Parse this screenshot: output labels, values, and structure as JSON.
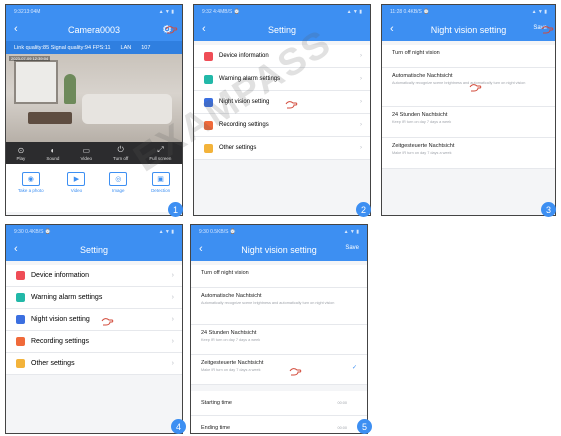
{
  "colors": {
    "accent": "#3d8ff2",
    "frame_border": "#444444",
    "badge": "#3d8ff2"
  },
  "watermark": "EXAMPASS",
  "panel1": {
    "status_left": "9:3213:04M",
    "status_right": "▲ ▼ ▮",
    "title": "Camera0003",
    "info": {
      "link_quality": "Link quality:85 Signal quality:94 FPS:11",
      "lan": "LAN",
      "rate": "107"
    },
    "cam_stamp": "2023-07-09 12:39:04",
    "controls": [
      {
        "icon": "play-icon",
        "glyph": "⊙",
        "label": "Play"
      },
      {
        "icon": "sound-icon",
        "glyph": "◐",
        "label": "Sound"
      },
      {
        "icon": "video-icon",
        "glyph": "▭",
        "label": "Video"
      },
      {
        "icon": "turn-off-icon",
        "glyph": "⏻",
        "label": "Turn off"
      },
      {
        "icon": "fullscreen-icon",
        "glyph": "⤢",
        "label": "Full screen"
      }
    ],
    "bottom": [
      {
        "icon": "camera-icon",
        "glyph": "◉",
        "label": "Take a photo"
      },
      {
        "icon": "video-file-icon",
        "glyph": "▶",
        "label": "Video"
      },
      {
        "icon": "image-icon",
        "glyph": "◎",
        "label": "Image"
      },
      {
        "icon": "detection-icon",
        "glyph": "▣",
        "label": "Detection"
      }
    ],
    "badge": "1"
  },
  "panel2": {
    "status_left": "9:32 4:4MB/S ⌚",
    "status_right": "▲ ▼ ▮",
    "title": "Setting",
    "items": [
      {
        "label": "Device information",
        "color": "#ef4d56"
      },
      {
        "label": "Warning alarm settings",
        "color": "#22b8a8"
      },
      {
        "label": "Night vision setting",
        "color": "#3b6fe0"
      },
      {
        "label": "Recording settings",
        "color": "#f06a3a"
      },
      {
        "label": "Other settings",
        "color": "#f3b33a"
      }
    ],
    "badge": "2"
  },
  "panel3": {
    "status_left": "11:28 0.4KB/S ⌚",
    "status_right": "▲ ▼ ▮",
    "title": "Night vision setting",
    "save": "Save",
    "items": [
      {
        "title": "Turn off night vision",
        "sub": ""
      },
      {
        "title": "Automatische Nachtsicht",
        "sub": "Automatically recognize scene brightness and automatically turn on night vision"
      },
      {
        "title": "24 Stunden Nachtsicht",
        "sub": "Keep IR turn on day 7 days a week"
      },
      {
        "title": "Zeitgesteuerte Nachtsicht",
        "sub": "Make IR turn on day 7 days a week"
      }
    ],
    "badge": "3"
  },
  "panel4": {
    "status_left": "9:30 0.4KB/S ⌚",
    "status_right": "▲ ▼ ▮",
    "title": "Setting",
    "items": [
      {
        "label": "Device information",
        "color": "#ef4d56"
      },
      {
        "label": "Warning alarm settings",
        "color": "#22b8a8"
      },
      {
        "label": "Night vision setting",
        "color": "#3b6fe0"
      },
      {
        "label": "Recording settings",
        "color": "#f06a3a"
      },
      {
        "label": "Other settings",
        "color": "#f3b33a"
      }
    ],
    "badge": "4"
  },
  "panel5": {
    "status_left": "9:30 0.5KB/S ⌚",
    "status_right": "▲ ▼ ▮",
    "title": "Night vision setting",
    "save": "Save",
    "items": [
      {
        "title": "Turn off night vision",
        "sub": ""
      },
      {
        "title": "Automatische Nachtsicht",
        "sub": "Automatically recognize scene brightness and automatically turn on night vision"
      },
      {
        "title": "24 Stunden Nachtsicht",
        "sub": "Keep IR turn on day 7 days a week"
      },
      {
        "title": "Zeitgesteuerte Nachtsicht",
        "sub": "Make IR turn on day 7 days a week"
      }
    ],
    "starting_time": {
      "label": "Starting time",
      "value": "00:00"
    },
    "ending_time": {
      "label": "Ending time",
      "value": "00:00"
    },
    "badge": "5"
  }
}
